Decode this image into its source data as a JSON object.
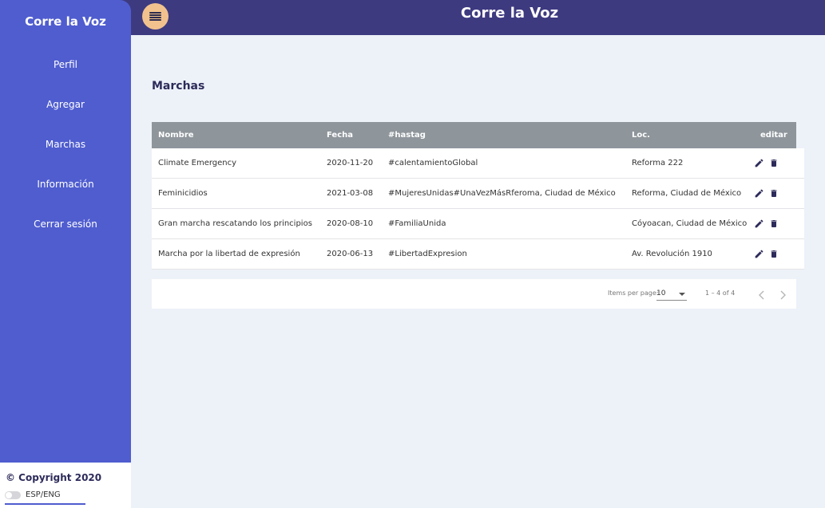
{
  "header": {
    "title": "Corre la Voz"
  },
  "sidebar": {
    "brand": "Corre la Voz",
    "items": [
      {
        "label": "Perfil"
      },
      {
        "label": "Agregar"
      },
      {
        "label": "Marchas"
      },
      {
        "label": "Información"
      },
      {
        "label": "Cerrar sesión"
      }
    ],
    "copyright": "© Copyright 2020",
    "language_toggle": "ESP/ENG"
  },
  "main": {
    "title": "Marchas",
    "table": {
      "columns": [
        "Nombre",
        "Fecha",
        "#hastag",
        "Loc.",
        "editar"
      ],
      "rows": [
        {
          "nombre": "Climate Emergency",
          "fecha": "2020-11-20",
          "hashtag": "#calentamientoGlobal",
          "loc": "Reforma 222"
        },
        {
          "nombre": "Feminicidios",
          "fecha": "2021-03-08",
          "hashtag": "#MujeresUnidas#UnaVezMásRferoma, Ciudad de México",
          "loc": "Reforma, Ciudad de México"
        },
        {
          "nombre": "Gran marcha rescatando los principios",
          "fecha": "2020-08-10",
          "hashtag": "#FamiliaUnida",
          "loc": "Cóyoacan, Ciudad de México"
        },
        {
          "nombre": "Marcha por la libertad de expresión",
          "fecha": "2020-06-13",
          "hashtag": "#LibertadExpresion",
          "loc": "Av. Revolución 1910"
        }
      ]
    },
    "paginator": {
      "items_per_page_label": "Items per page:",
      "items_per_page_value": "10",
      "range_label": "1 – 4 of 4"
    }
  },
  "icons": {
    "edit": "pencil-icon",
    "delete": "trash-icon",
    "menu": "hamburger-menu-icon",
    "prev": "chevron-left-icon",
    "next": "chevron-right-icon"
  },
  "colors": {
    "sidebar": "#4f5dcf",
    "topbar": "#3d3a80",
    "menu_button": "#f2c28e",
    "table_header": "#8e959b",
    "background": "#edf1f8",
    "icon": "#2d2b5a"
  }
}
